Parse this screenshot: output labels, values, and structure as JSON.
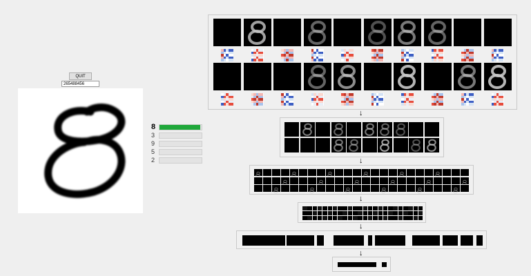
{
  "controls": {
    "quit_label": "QUIT",
    "seed_value": "265488456"
  },
  "input_digit": {
    "rows": 28,
    "cols": 28
  },
  "predictions": [
    {
      "digit": "8",
      "confidence": 0.97
    },
    {
      "digit": "3",
      "confidence": 0.0
    },
    {
      "digit": "9",
      "confidence": 0.0
    },
    {
      "digit": "5",
      "confidence": 0.0
    },
    {
      "digit": "2",
      "confidence": 0.0
    }
  ],
  "layers": {
    "conv1": {
      "feature_maps": 20,
      "rows": 2,
      "per_row": 10
    },
    "conv2": {
      "feature_maps": 20,
      "rows": 2,
      "per_row": 10
    },
    "conv3": {
      "feature_maps": 40,
      "rows": 3
    },
    "conv4": {
      "feature_maps": 40,
      "rows": 3
    },
    "dense": {
      "units": 1
    },
    "output": {
      "units": 1
    }
  },
  "arrow_glyph": "↓",
  "colors": {
    "accent": "#1fa83a",
    "panel_bg": "#f0f0f0",
    "map_bg": "#000000"
  }
}
